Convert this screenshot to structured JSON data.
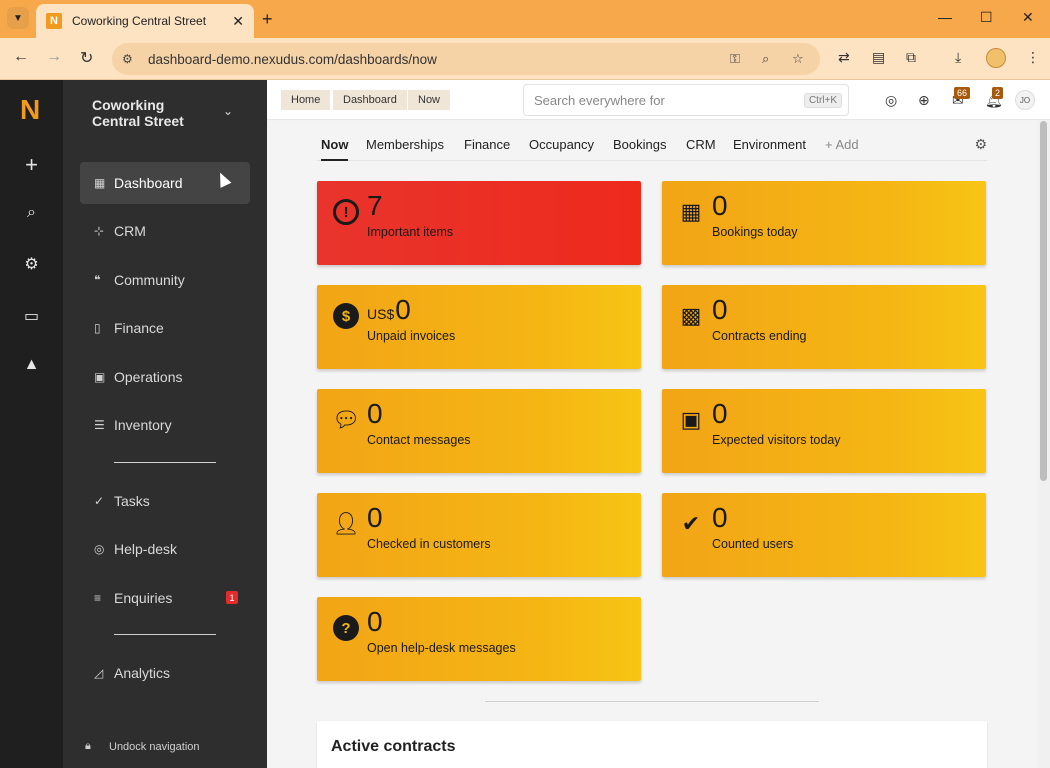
{
  "browser": {
    "tab_title": "Coworking Central Street",
    "url": "dashboard-demo.nexudus.com/dashboards/now",
    "favicon_letter": "N"
  },
  "rail": {
    "logo": "N"
  },
  "sidebar": {
    "location_name": "Coworking Central Street",
    "items": [
      {
        "label": "Dashboard",
        "icon": "grid-icon"
      },
      {
        "label": "CRM",
        "icon": "org-chart-icon"
      },
      {
        "label": "Community",
        "icon": "quote-icon"
      },
      {
        "label": "Finance",
        "icon": "document-icon"
      },
      {
        "label": "Operations",
        "icon": "chip-icon"
      },
      {
        "label": "Inventory",
        "icon": "list-icon"
      },
      {
        "label": "Tasks",
        "icon": "check-icon"
      },
      {
        "label": "Help-desk",
        "icon": "lifebuoy-icon"
      },
      {
        "label": "Enquiries",
        "icon": "lines-icon",
        "badge": "1"
      },
      {
        "label": "Analytics",
        "icon": "chart-icon"
      }
    ],
    "undock_label": "Undock navigation"
  },
  "appbar": {
    "breadcrumbs": [
      "Home",
      "Dashboard",
      "Now"
    ],
    "search_placeholder": "Search everywhere for",
    "search_shortcut": "Ctrl+K",
    "messages_count": "66",
    "notifications_count": "2",
    "user_initials": "JO"
  },
  "dashboard": {
    "tabs": [
      "Now",
      "Memberships",
      "Finance",
      "Occupancy",
      "Bookings",
      "CRM",
      "Environment",
      "+ Add"
    ],
    "active_tab": "Now",
    "tiles": [
      {
        "value": "7",
        "label": "Important items",
        "icon": "alert-icon",
        "color": "#ea2f23"
      },
      {
        "value": "0",
        "label": "Bookings today",
        "icon": "calendar-icon",
        "color": "#f5b614"
      },
      {
        "prefix": "US$",
        "value": "0",
        "label": "Unpaid invoices",
        "icon": "dollar-icon",
        "color": "#f5b614"
      },
      {
        "value": "0",
        "label": "Contracts ending",
        "icon": "calendar-clock-icon",
        "color": "#f5b614"
      },
      {
        "value": "0",
        "label": "Contact messages",
        "icon": "chat-icon",
        "color": "#f5b614"
      },
      {
        "value": "0",
        "label": "Expected visitors today",
        "icon": "badge-icon",
        "color": "#f5b614"
      },
      {
        "value": "0",
        "label": "Checked in customers",
        "icon": "user-icon",
        "color": "#f5b614"
      },
      {
        "value": "0",
        "label": "Counted users",
        "icon": "checkmark-icon",
        "color": "#f5b614"
      },
      {
        "value": "0",
        "label": "Open help-desk messages",
        "icon": "question-icon",
        "color": "#f5b614"
      }
    ],
    "section_title": "Active contracts"
  },
  "colors": {
    "browser_frame": "#f6a84a",
    "brand": "#f29a1f",
    "sidebar_bg": "#2e2e2e",
    "rail_bg": "#1f1f1f",
    "alert_tile": "#ea2f23",
    "tile": "#f5b614"
  }
}
